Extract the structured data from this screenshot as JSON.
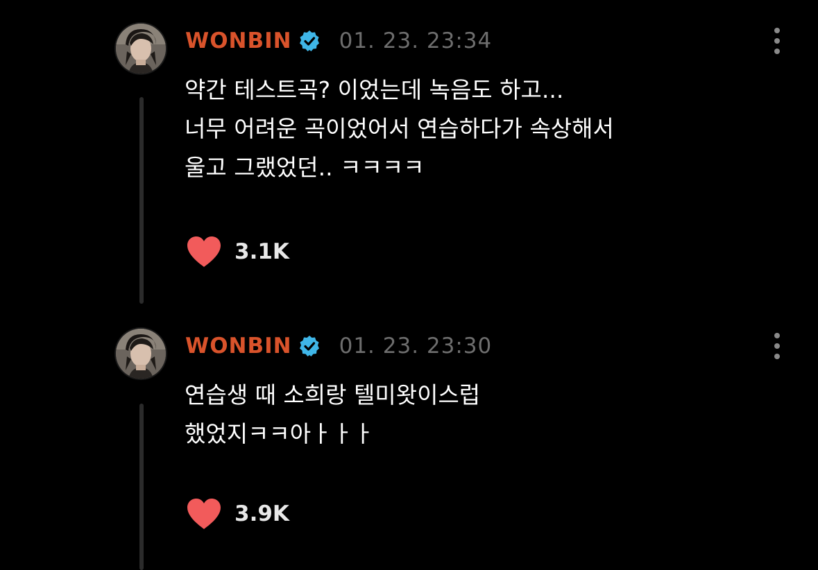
{
  "colors": {
    "background": "#000000",
    "username": "#d9532b",
    "verified_badge": "#3fb6e8",
    "timestamp": "#6e6e6e",
    "heart": "#f25b5b",
    "text": "#ffffff"
  },
  "icons": {
    "verified": "verified-badge-icon",
    "like": "heart-icon",
    "more": "more-vertical-icon"
  },
  "posts": [
    {
      "username": "WONBIN",
      "timestamp": "01. 23. 23:34",
      "text_lines": [
        "약간 테스트곡? 이었는데 녹음도 하고...",
        "너무 어려운 곡이었어서 연습하다가 속상해서",
        "울고 그랬었던.. ㅋㅋㅋㅋ"
      ],
      "likes": "3.1K",
      "liked": true
    },
    {
      "username": "WONBIN",
      "timestamp": "01. 23. 23:30",
      "text_lines": [
        "연습생 때 소희랑 텔미왓이스럽",
        "했었지ㅋㅋ아ㅏㅏㅏ"
      ],
      "likes": "3.9K",
      "liked": true
    }
  ]
}
